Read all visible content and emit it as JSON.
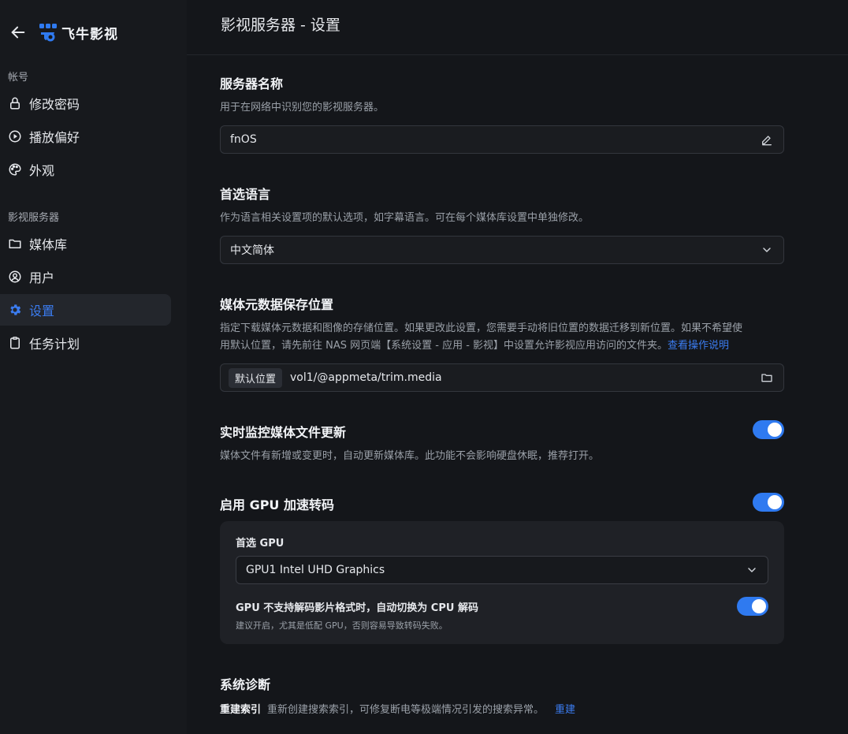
{
  "app": {
    "name": "飞牛影视",
    "colors": {
      "accent": "#2f7af0",
      "link": "#3b7cf0",
      "background": "#14161a",
      "sidebar": "#17191d"
    }
  },
  "sidebar": {
    "groups": [
      {
        "label": "帐号",
        "items": [
          {
            "label": "修改密码",
            "icon": "lock-icon"
          },
          {
            "label": "播放偏好",
            "icon": "play-circle-icon"
          },
          {
            "label": "外观",
            "icon": "palette-icon"
          }
        ]
      },
      {
        "label": "影视服务器",
        "items": [
          {
            "label": "媒体库",
            "icon": "folder-icon"
          },
          {
            "label": "用户",
            "icon": "user-circle-icon"
          },
          {
            "label": "设置",
            "icon": "gear-icon",
            "active": true
          },
          {
            "label": "任务计划",
            "icon": "clipboard-icon"
          }
        ]
      }
    ]
  },
  "header": {
    "title": "影视服务器 - 设置"
  },
  "settings": {
    "server_name": {
      "title": "服务器名称",
      "desc": "用于在网络中识别您的影视服务器。",
      "value": "fnOS"
    },
    "language": {
      "title": "首选语言",
      "desc": "作为语言相关设置项的默认选项，如字幕语言。可在每个媒体库设置中单独修改。",
      "value": "中文简体"
    },
    "metadata": {
      "title": "媒体元数据保存位置",
      "desc_line1": "指定下载媒体元数据和图像的存储位置。如果更改此设置，您需要手动将旧位置的数据迁移到新位置。如果不希望使",
      "desc_line2": "用默认位置，请先前往 NAS 网页端【系统设置 - 应用 - 影视】中设置允许影视应用访问的文件夹。",
      "link": "查看操作说明",
      "chip": "默认位置",
      "path": "vol1/@appmeta/trim.media"
    },
    "realtime_monitor": {
      "title": "实时监控媒体文件更新",
      "desc": "媒体文件有新增或变更时，自动更新媒体库。此功能不会影响硬盘休眠，推荐打开。",
      "enabled": true
    },
    "gpu": {
      "title": "启用 GPU 加速转码",
      "enabled": true,
      "preferred_label": "首选 GPU",
      "preferred_value": "GPU1 Intel UHD Graphics",
      "fallback_title": "GPU 不支持解码影片格式时，自动切换为 CPU 解码",
      "fallback_desc": "建议开启，尤其是低配 GPU，否则容易导致转码失败。",
      "fallback_enabled": true
    },
    "diagnostics": {
      "title": "系统诊断",
      "reindex_label": "重建索引",
      "reindex_desc": "重新创建搜索索引，可修复断电等极端情况引发的搜索异常。",
      "reindex_action": "重建"
    }
  }
}
